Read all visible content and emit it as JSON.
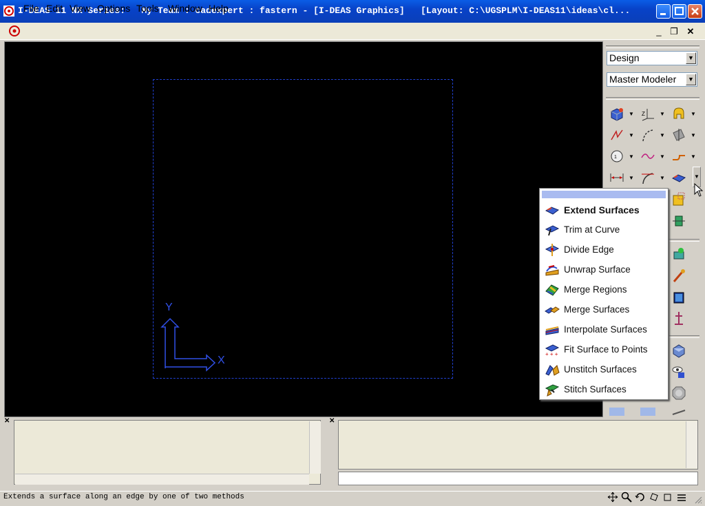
{
  "window": {
    "title": "I-DEAS 11 NX Series:   My Team : cadexpert : fastern - [I-DEAS Graphics]   [Layout: C:\\UGSPLM\\I-DEAS11\\ideas\\cl...",
    "minimize_label": "_",
    "maximize_label": "□",
    "close_label": "✕"
  },
  "menu": {
    "items": [
      "File",
      "Edit",
      "View",
      "Options",
      "Tools",
      "Window",
      "Help"
    ],
    "mdi": {
      "minimize": "_",
      "restore": "❐",
      "close": "✕"
    }
  },
  "viewport": {
    "axis_y_label": "Y",
    "axis_x_label": "X",
    "axis_color": "#3050e8",
    "frame_color": "#2040d0"
  },
  "panel": {
    "task": "Design",
    "application": "Master Modeler"
  },
  "toolbar": {
    "icons": [
      "block-icon",
      "coordinate-icon",
      "profile-icon",
      "polyline-icon",
      "curve-icon",
      "plane-icon",
      "circle-icon",
      "spline-icon",
      "fillet-icon",
      "dimension-icon",
      "tangent-icon",
      "surface-icon",
      "shade-icon",
      "paint-icon",
      "cylinder-icon",
      "figure-icon",
      "solid-icon",
      "view-icon",
      "render-icon",
      "ruler-icon"
    ]
  },
  "popup": {
    "items": [
      {
        "label": "Extend Surfaces",
        "icon": "extend-surfaces-icon",
        "bold": true
      },
      {
        "label": "Trim at Curve",
        "icon": "trim-curve-icon"
      },
      {
        "label": "Divide Edge",
        "icon": "divide-edge-icon"
      },
      {
        "label": "Unwrap Surface",
        "icon": "unwrap-surface-icon"
      },
      {
        "label": "Merge Regions",
        "icon": "merge-regions-icon"
      },
      {
        "label": "Merge Surfaces",
        "icon": "merge-surfaces-icon"
      },
      {
        "label": "Interpolate Surfaces",
        "icon": "interpolate-surfaces-icon"
      },
      {
        "label": "Fit Surface to Points",
        "icon": "fit-surface-icon"
      },
      {
        "label": "Unstitch Surfaces",
        "icon": "unstitch-surfaces-icon"
      },
      {
        "label": "Stitch Surfaces",
        "icon": "stitch-surfaces-icon"
      }
    ]
  },
  "status": {
    "message": "Extends a surface along an edge by one of two methods"
  },
  "colors": {
    "titlebar": "#0842c8",
    "highlight": "#a9bbf0"
  }
}
